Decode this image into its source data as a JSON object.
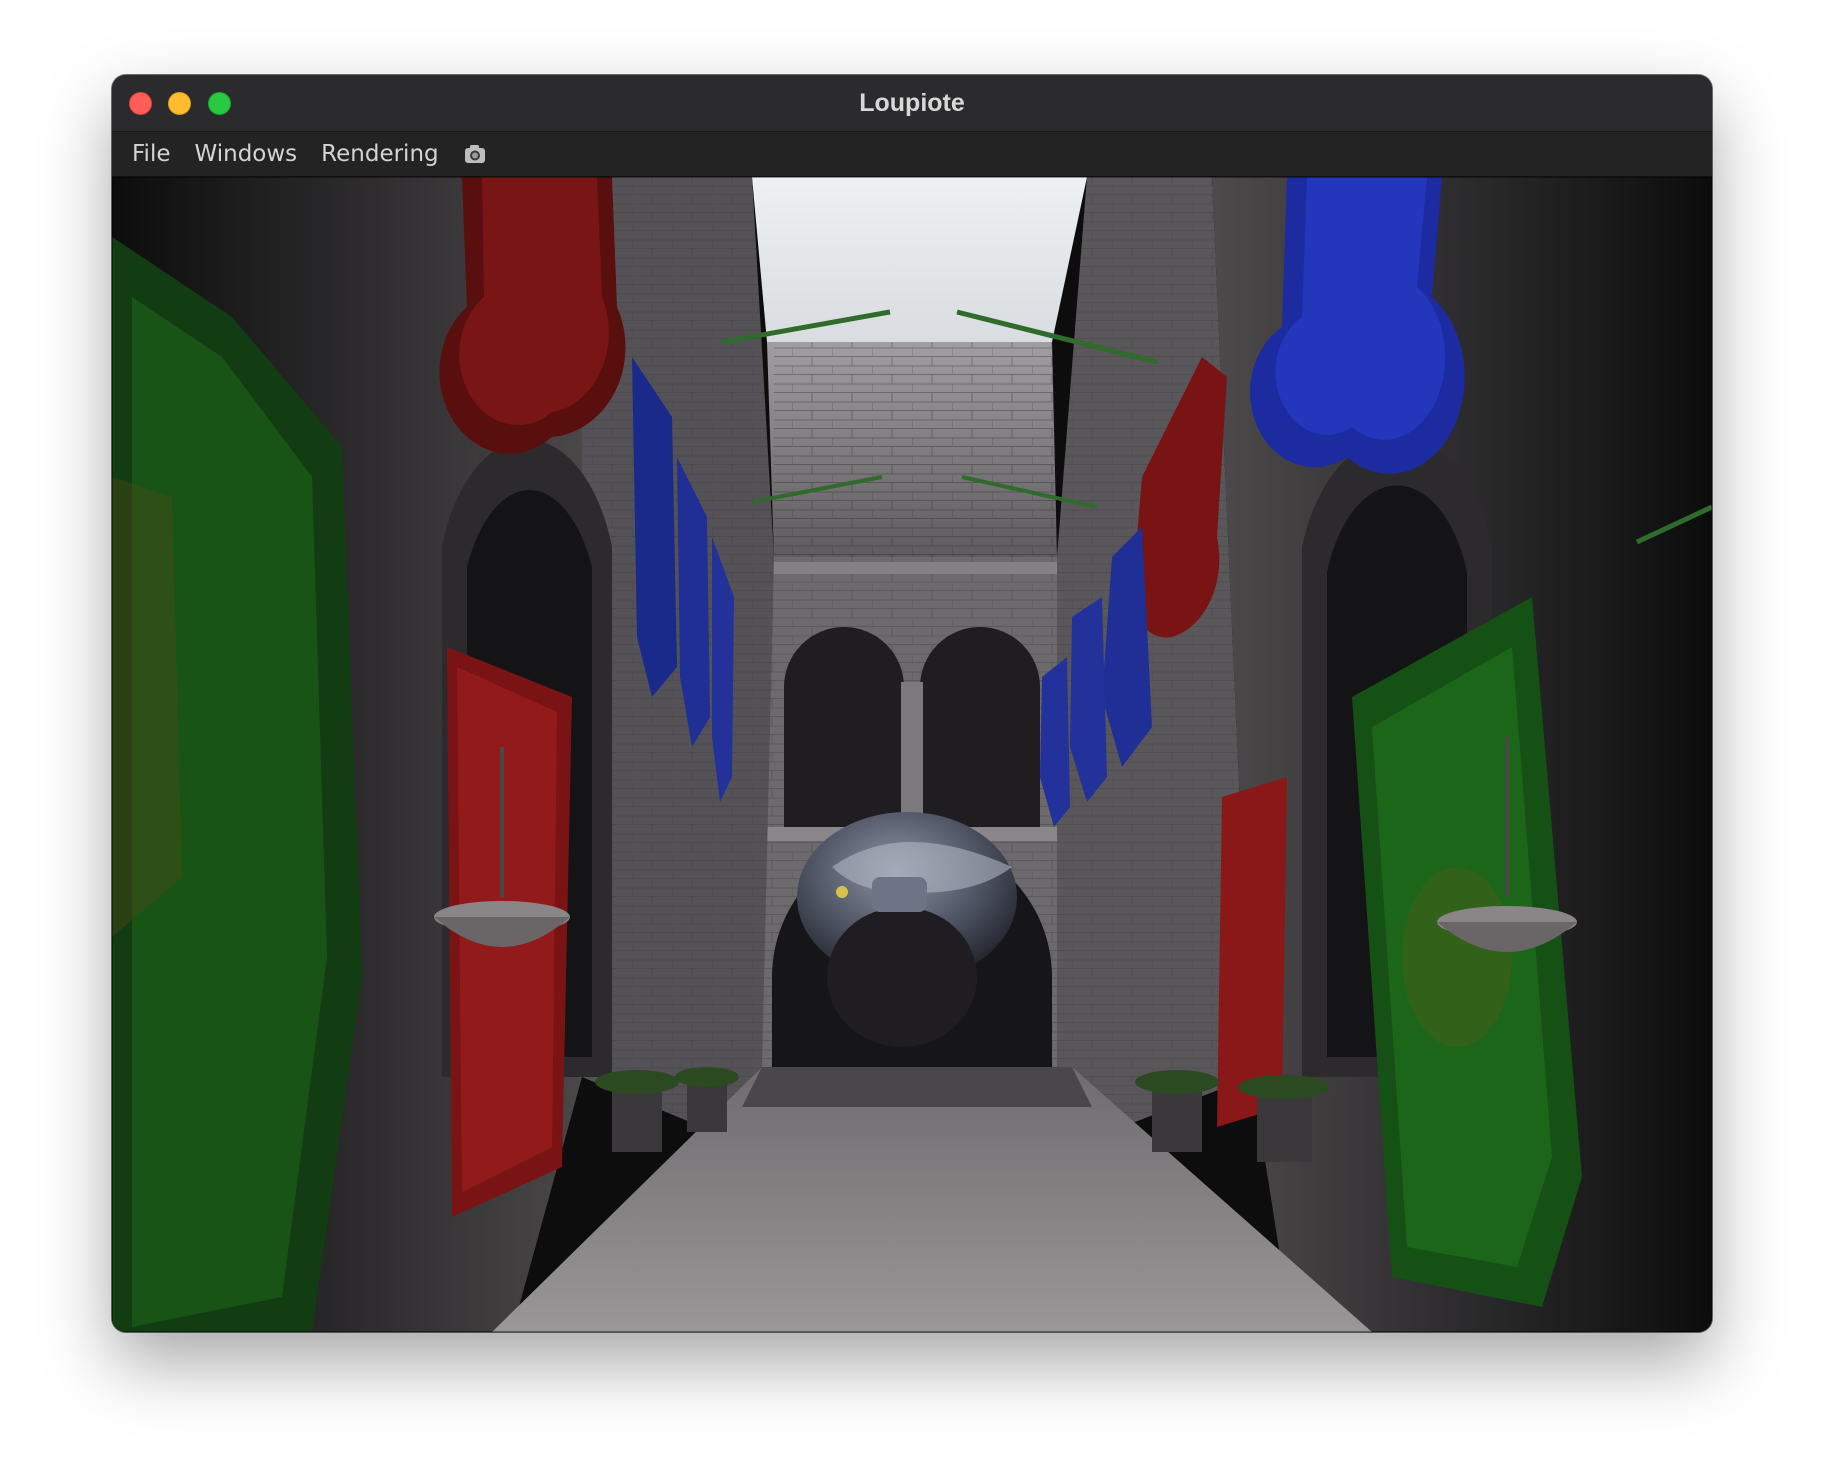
{
  "window": {
    "title": "Loupiote",
    "traffic_lights": {
      "close": "#ff5f57",
      "minimize": "#febc2e",
      "maximize": "#28c840"
    }
  },
  "menubar": {
    "items": [
      {
        "label": "File"
      },
      {
        "label": "Windows"
      },
      {
        "label": "Rendering"
      }
    ],
    "camera_icon": "camera-icon"
  },
  "viewport": {
    "content": "rendered-scene"
  }
}
